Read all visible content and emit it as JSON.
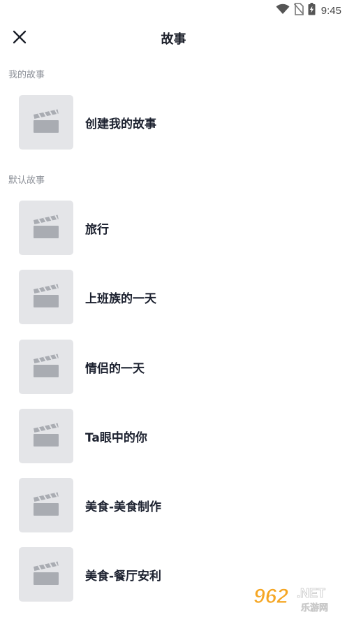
{
  "status_bar": {
    "time": "9:45",
    "icons": [
      "wifi-icon",
      "no-sim-icon",
      "battery-charging-icon"
    ]
  },
  "header": {
    "title": "故事",
    "close_icon": "close-icon"
  },
  "sections": {
    "mine": {
      "label": "我的故事",
      "items": [
        {
          "label": "创建我的故事",
          "icon": "clapperboard-icon"
        }
      ]
    },
    "default": {
      "label": "默认故事",
      "items": [
        {
          "label": "旅行",
          "icon": "clapperboard-icon"
        },
        {
          "label": "上班族的一天",
          "icon": "clapperboard-icon"
        },
        {
          "label": "情侣的一天",
          "icon": "clapperboard-icon"
        },
        {
          "label": "Ta眼中的你",
          "icon": "clapperboard-icon"
        },
        {
          "label": "美食-美食制作",
          "icon": "clapperboard-icon"
        },
        {
          "label": "美食-餐厅安利",
          "icon": "clapperboard-icon"
        }
      ]
    }
  },
  "watermark": {
    "number": "962",
    "suffix": ".NET",
    "subtitle": "乐游网"
  },
  "colors": {
    "thumb_bg": "#e4e5e8",
    "clapper_fill": "#a9acb2",
    "section_label": "#8b8f97",
    "title_text": "#1b1f29",
    "watermark_orange": "#f5a623"
  }
}
